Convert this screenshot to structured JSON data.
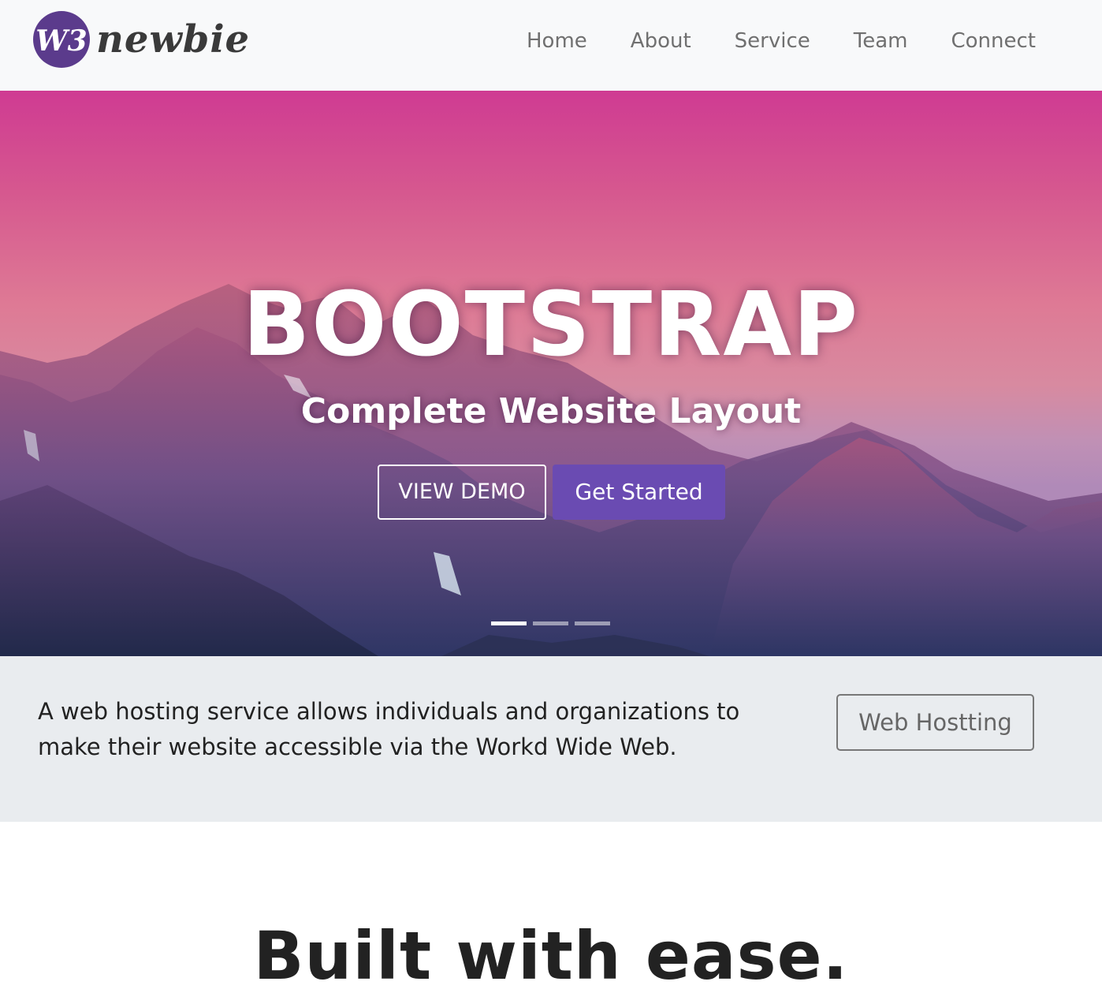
{
  "brand": {
    "name": "newbie",
    "mark_text": "W3"
  },
  "nav": {
    "items": [
      {
        "label": "Home"
      },
      {
        "label": "About"
      },
      {
        "label": "Service"
      },
      {
        "label": "Team"
      },
      {
        "label": "Connect"
      }
    ]
  },
  "hero": {
    "title": "BOOTSTRAP",
    "subtitle": "Complete Website Layout",
    "demo_button": "VIEW DEMO",
    "start_button": "Get Started",
    "slides": {
      "count": 3,
      "active_index": 0
    }
  },
  "band": {
    "text": "A web hosting service allows individuals and organizations to make their website accessible via the Workd Wide Web.",
    "button": "Web Hostting"
  },
  "section": {
    "title": "Built with ease."
  },
  "colors": {
    "nav_bg": "#f8f9fa",
    "brand_purple": "#5b3b8c",
    "cta_purple": "#6a4bb2",
    "band_bg": "#e9ecef"
  }
}
